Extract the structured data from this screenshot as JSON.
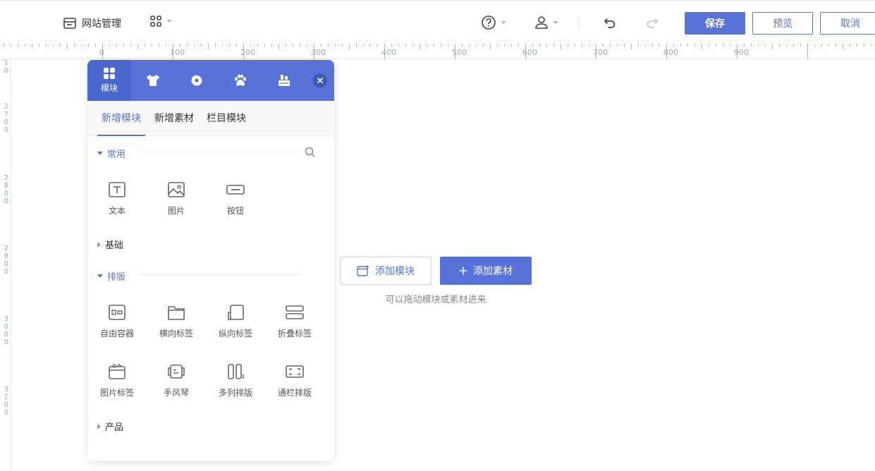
{
  "topbar": {
    "site_mgmt_label": "网站管理",
    "save_label": "保存",
    "preview_label": "预览",
    "cancel_label": "取消"
  },
  "ruler": {
    "top_labels": [
      "0",
      "100",
      "200",
      "300",
      "400",
      "500",
      "600",
      "700",
      "800",
      "900"
    ],
    "left_labels": [
      "10",
      "2700",
      "2800",
      "2900",
      "3000",
      "3100"
    ]
  },
  "canvas": {
    "add_module_label": "添加模块",
    "add_asset_label": "添加素材",
    "hint": "可以拖动模块或素材进来"
  },
  "panel": {
    "tabs": [
      {
        "label": "模块",
        "icon": "grid-icon"
      },
      {
        "label": "",
        "icon": "tshirt-icon"
      },
      {
        "label": "",
        "icon": "gear-icon"
      },
      {
        "label": "",
        "icon": "paw-icon"
      },
      {
        "label": "",
        "icon": "layers-icon"
      }
    ],
    "subtabs": [
      "新增模块",
      "新增素材",
      "栏目模块"
    ],
    "sections": {
      "common": "常用",
      "basic": "基础",
      "layout": "排版",
      "product": "产品"
    },
    "common_items": [
      "文本",
      "图片",
      "按钮"
    ],
    "layout_items": [
      "自由容器",
      "横向标签",
      "纵向标签",
      "折叠标签",
      "图片标签",
      "手风琴",
      "多列排版",
      "通栏排版"
    ]
  },
  "colors": {
    "accent": "#5773d9",
    "accent_dark": "#4a66cf"
  }
}
